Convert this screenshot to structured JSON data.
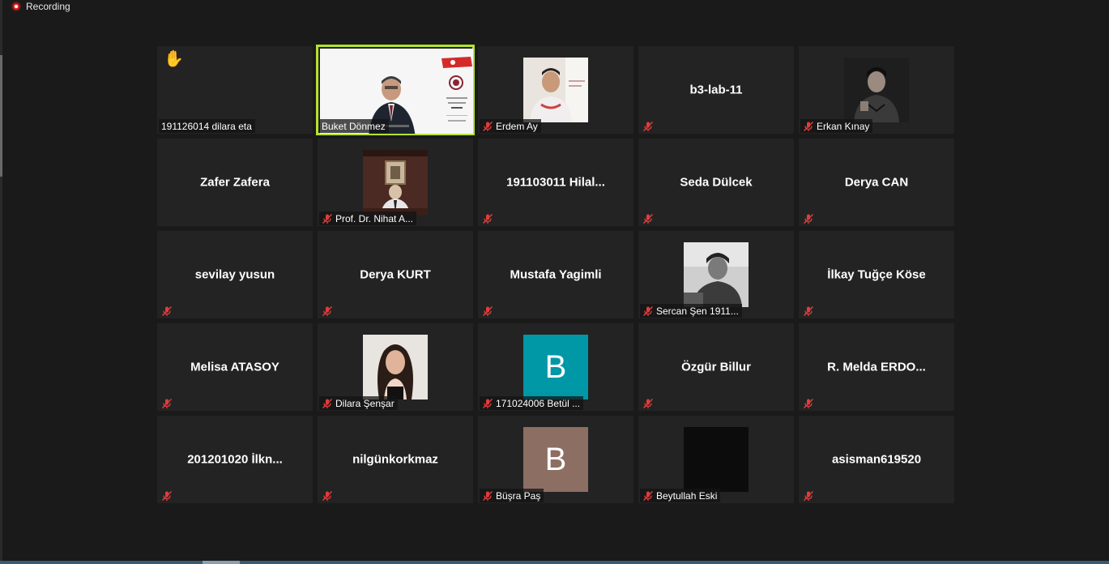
{
  "recording": {
    "label": "Recording"
  },
  "participants": [
    {
      "name": "191126014 dilara eta",
      "label": "191126014 dilara eta",
      "hand_raised": true,
      "muted": false,
      "type": "empty"
    },
    {
      "name": "Buket Dönmez",
      "label": "Buket Dönmez",
      "muted": false,
      "type": "video-slide",
      "active": true
    },
    {
      "name": "Erdem Ay",
      "label": "Erdem Ay",
      "muted": true,
      "type": "photo-man1"
    },
    {
      "name": "b3-lab-11",
      "label": "",
      "muted": true,
      "type": "name"
    },
    {
      "name": "Erkan Kınay",
      "label": "Erkan Kınay",
      "muted": true,
      "type": "photo-man2"
    },
    {
      "name": "Zafer Zafera",
      "label": "",
      "muted": false,
      "type": "name"
    },
    {
      "name": "Prof. Dr. Nihat A...",
      "label": "Prof. Dr. Nihat A...",
      "muted": true,
      "type": "photo-office"
    },
    {
      "name": "191103011 Hilal...",
      "label": "",
      "muted": true,
      "type": "name"
    },
    {
      "name": "Seda Dülcek",
      "label": "",
      "muted": true,
      "type": "name"
    },
    {
      "name": "Derya CAN",
      "label": "",
      "muted": true,
      "type": "name"
    },
    {
      "name": "sevilay yusun",
      "label": "",
      "muted": true,
      "type": "name"
    },
    {
      "name": "Derya KURT",
      "label": "",
      "muted": true,
      "type": "name"
    },
    {
      "name": "Mustafa Yagimli",
      "label": "",
      "muted": true,
      "type": "name"
    },
    {
      "name": "Sercan Şen 1911...",
      "label": "Sercan Şen 1911...",
      "muted": true,
      "type": "photo-bw"
    },
    {
      "name": "İlkay Tuğçe Köse",
      "label": "",
      "muted": true,
      "type": "name"
    },
    {
      "name": "Melisa ATASOY",
      "label": "",
      "muted": true,
      "type": "name"
    },
    {
      "name": "Dilara Şenşar",
      "label": "Dilara Şenşar",
      "muted": true,
      "type": "photo-woman"
    },
    {
      "name": "171024006 Betül ...",
      "label": "171024006 Betül ...",
      "muted": true,
      "type": "letter",
      "letter": "B",
      "color": "#0097a7"
    },
    {
      "name": "Özgür Billur",
      "label": "",
      "muted": true,
      "type": "name"
    },
    {
      "name": "R. Melda ERDO...",
      "label": "",
      "muted": true,
      "type": "name"
    },
    {
      "name": "201201020 İlkn...",
      "label": "",
      "muted": true,
      "type": "name"
    },
    {
      "name": "nilgünkorkmaz",
      "label": "",
      "muted": true,
      "type": "name"
    },
    {
      "name": "Büşra Paş",
      "label": "Büşra Paş",
      "muted": true,
      "type": "letter",
      "letter": "B",
      "color": "#8d6e63"
    },
    {
      "name": "Beytullah Eski",
      "label": "Beytullah Eski",
      "muted": true,
      "type": "black"
    },
    {
      "name": "asisman619520",
      "label": "",
      "muted": true,
      "type": "name"
    }
  ]
}
